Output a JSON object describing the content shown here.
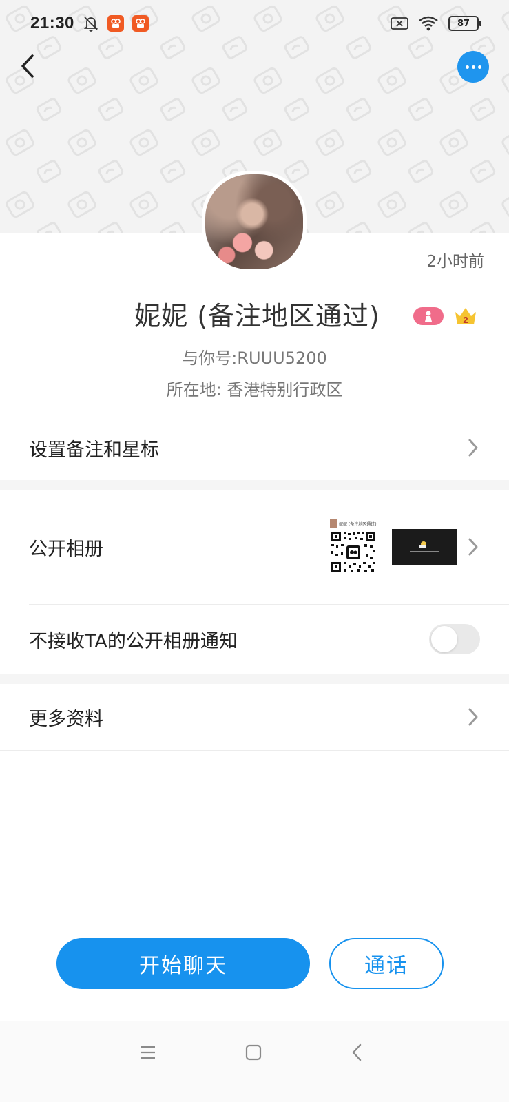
{
  "status_bar": {
    "time": "21:30",
    "battery": "87"
  },
  "profile": {
    "time_ago": "2小时前",
    "name": "妮妮 (备注地区通过)",
    "id_line": "与你号:RUUU5200",
    "location_line": "所在地: 香港特别行政区",
    "crown_level": "2"
  },
  "menu": {
    "set_remark": "设置备注和星标",
    "public_album": "公开相册",
    "album_qr_caption": "妮妮 (备注地区通过)",
    "no_album_notify": "不接收TA的公开相册通知",
    "no_album_notify_on": false,
    "more_info": "更多资料"
  },
  "actions": {
    "start_chat": "开始聊天",
    "call": "通话"
  },
  "colors": {
    "accent": "#1792ee",
    "header_bg": "#f3f3f3"
  },
  "icons": {
    "back": "back-arrow-icon",
    "more": "more-dots-icon",
    "mute": "bell-off-icon",
    "wifi": "wifi-icon",
    "battery": "battery-icon",
    "chevron": "chevron-right-icon"
  }
}
